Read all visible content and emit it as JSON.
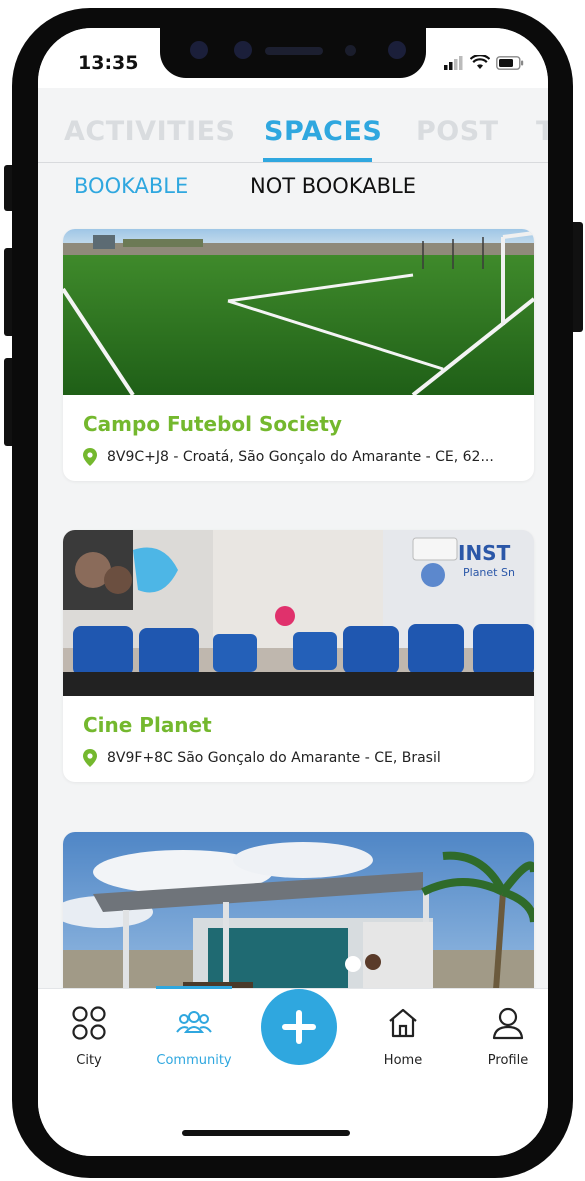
{
  "status_bar": {
    "time": "13:35"
  },
  "top_tabs": [
    {
      "label": "ACTIVITIES",
      "active": false
    },
    {
      "label": "SPACES",
      "active": true
    },
    {
      "label": "POST",
      "active": false
    },
    {
      "label": "TO",
      "active": false
    }
  ],
  "sub_tabs": [
    {
      "label": "BOOKABLE",
      "active": true
    },
    {
      "label": "NOT BOOKABLE",
      "active": false
    }
  ],
  "spaces": [
    {
      "title": "Campo Futebol Society",
      "address": "8V9C+J8 - Croatá, São Gonçalo do Amarante - CE, 62...",
      "image": "soccer-field-photo"
    },
    {
      "title": "Cine Planet",
      "address": "8V9F+8C São Gonçalo do Amarante - CE, Brasil",
      "image": "cinema-room-photo"
    },
    {
      "title": "",
      "address": "",
      "image": "pavilion-building-photo"
    }
  ],
  "bottom_nav": [
    {
      "label": "City",
      "icon": "four-circles-icon",
      "active": false
    },
    {
      "label": "Community",
      "icon": "community-icon",
      "active": true
    },
    {
      "label": "Home",
      "icon": "home-icon",
      "active": false
    },
    {
      "label": "Profile",
      "icon": "profile-icon",
      "active": false
    }
  ],
  "fab": {
    "icon": "plus-icon"
  },
  "colors": {
    "accent": "#2fa7df",
    "title_green": "#74b82e",
    "inactive_tab": "#d9dcdf",
    "background": "#f3f4f5"
  }
}
